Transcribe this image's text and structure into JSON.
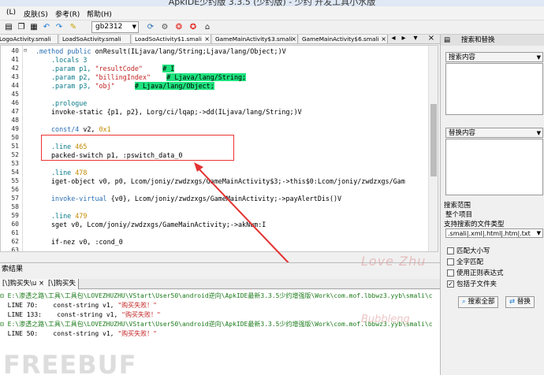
{
  "window": {
    "title": "ApkIDE少约版 3.3.5 (少约版) - 少约 开发工具小水版"
  },
  "menu": {
    "items": [
      "(L)",
      "皮肤(S)",
      "参考(R)",
      "帮助(H)"
    ]
  },
  "toolbar": {
    "encoding": "gb2312"
  },
  "tabs": [
    "LogoActivity.smali",
    "LoadSoActivity.smali",
    "LoadSoActivity$1.smali",
    "GameMainActivity$3.smali",
    "GameMainActivity$6.smali"
  ],
  "editor": {
    "line_numbers": [
      "40",
      "41",
      "42",
      "43",
      "44",
      "45",
      "46",
      "47",
      "48",
      "49",
      "50",
      "51",
      "52",
      "53",
      "54",
      "55",
      "56",
      "57",
      "58",
      "59",
      "60",
      "61",
      "62",
      "63"
    ],
    "code": {
      "l40_kw": ".method public",
      "l40_rest": " onResult(ILjava/lang/String;Ljava/lang/Object;)V",
      "l41": ".locals 3",
      "l42_dir": ".param p1, ",
      "l42_str": "\"resultCode\"",
      "l42_hl": "# I",
      "l43_dir": ".param p2, ",
      "l43_str": "\"billingIndex\"",
      "l43_hl": "# Ljava/lang/String;",
      "l44_dir": ".param p3, ",
      "l44_str": "\"obj\"",
      "l44_hl": "# Ljava/lang/Object;",
      "l46": ".prologue",
      "l47": "invoke-static {p1, p2}, Lorg/ci/lqap;->dd(ILjava/lang/String;)V",
      "l49_kw": "const/4",
      "l49_rest": " v2, ",
      "l49_num": "0x1",
      "l51_kw": ".line",
      "l51_num": " 465",
      "l52": "packed-switch p1, :pswitch_data_0",
      "l54_kw": ".line",
      "l54_num": " 478",
      "l55": "iget-object v0, p0, Lcom/joniy/zwdzxgs/GameMainActivity$3;->this$0:Lcom/joniy/zwdzxgs/Gam",
      "l57_kw": "invoke-virtual",
      "l57_rest": " {v0}, Lcom/joniy/zwdzxgs/GameMainActivity;->payAlertDis()V",
      "l59_kw": ".line",
      "l59_num": " 479",
      "l60": "sget v0, Lcom/joniy/zwdzxgs/GameMainActivity;->akNum:I",
      "l62": "if-nez v0, :cond_0"
    }
  },
  "results": {
    "title": "索结果",
    "tabs": [
      "[\\]购买失\\u ×",
      "[\\]购买失"
    ],
    "lines": [
      {
        "type": "file",
        "text": "E:\\渗透之路\\工具\\工具包\\LOVEZHUZHU\\VStart\\User50\\android逆向\\ApkIDE最新3.3.5少约增强版\\Work\\com.mof.lbbwz3.yyb\\smali\\c"
      },
      {
        "type": "hit",
        "prefix": "  LINE 70:    const-string v1, ",
        "str": "\"购买失败！\""
      },
      {
        "type": "hit",
        "prefix": "  LINE 133:    const-string v1, ",
        "str": "\"购买失败！\""
      },
      {
        "type": "file",
        "text": "E:\\渗透之路\\工具\\工具包\\LOVEZHUZHU\\VStart\\User50\\android逆向\\ApkIDE最新3.3.5少约增强版\\Work\\com.mof.lbbwz3.yyb\\smali\\c"
      },
      {
        "type": "hit",
        "prefix": "  LINE 50:    const-string v1, ",
        "str": "\"购买失败！\""
      }
    ]
  },
  "watermarks": {
    "love": "Love Zhu",
    "bubble": "Bubbleng",
    "freebuf": "FREEBUF"
  },
  "panel": {
    "title": "搜索和替换",
    "search_label": "搜索内容",
    "replace_label": "替换内容",
    "scope_label": "搜索范围",
    "scope_value": "整个项目",
    "filetype_label": "支持搜索的文件类型",
    "filetype_value": ".smali|.xml|.html|.htm|.txt",
    "options": [
      {
        "label": "匹配大小写",
        "checked": false
      },
      {
        "label": "全字匹配",
        "checked": false
      },
      {
        "label": "使用正则表达式",
        "checked": false
      },
      {
        "label": "包括子文件夹",
        "checked": true
      }
    ],
    "search_all": "搜索全部",
    "replace": "替换"
  },
  "colors": {
    "highlight": "#1ee37e",
    "annotation": "#e33333",
    "string": "#c32222",
    "keyword": "#2a6fb3"
  }
}
